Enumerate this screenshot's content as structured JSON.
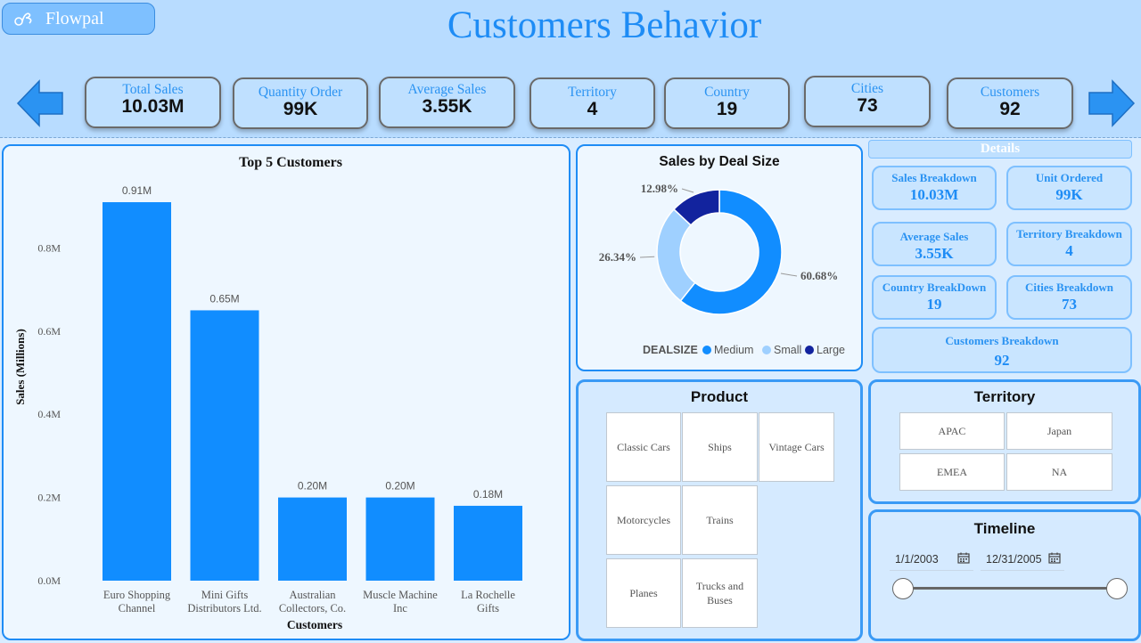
{
  "brand": {
    "name": "Flowpal"
  },
  "header": {
    "title": "Customers Behavior"
  },
  "nav": {
    "prev": "left-arrow-icon",
    "next": "right-arrow-icon"
  },
  "kpis": [
    {
      "label": "Total Sales",
      "value": "10.03M"
    },
    {
      "label": "Quantity Order",
      "value": "99K"
    },
    {
      "label": "Average Sales",
      "value": "3.55K"
    },
    {
      "label": "Territory",
      "value": "4"
    },
    {
      "label": "Country",
      "value": "19"
    },
    {
      "label": "Cities",
      "value": "73"
    },
    {
      "label": "Customers",
      "value": "92"
    }
  ],
  "chart_data": [
    {
      "type": "bar",
      "title": "Top 5 Customers",
      "xlabel": "Customers",
      "ylabel": "Sales (Millions)",
      "categories": [
        "Euro Shopping Channel",
        "Mini Gifts Distributors Ltd.",
        "Australian Collectors, Co.",
        "Muscle Machine Inc",
        "La Rochelle Gifts"
      ],
      "category_lines": [
        [
          "Euro Shopping",
          "Channel"
        ],
        [
          "Mini Gifts",
          "Distributors Ltd."
        ],
        [
          "Australian",
          "Collectors, Co."
        ],
        [
          "Muscle Machine",
          "Inc"
        ],
        [
          "La Rochelle",
          "Gifts"
        ]
      ],
      "values": [
        0.91,
        0.65,
        0.2,
        0.2,
        0.18
      ],
      "data_labels": [
        "0.91M",
        "0.65M",
        "0.20M",
        "0.20M",
        "0.18M"
      ],
      "yticks": [
        0,
        0.2,
        0.4,
        0.6,
        0.8
      ],
      "ytick_labels": [
        "0.0M",
        "0.2M",
        "0.4M",
        "0.6M",
        "0.8M"
      ],
      "ylim": [
        0,
        0.96
      ],
      "color": "#118dff"
    },
    {
      "type": "pie",
      "subtype": "donut",
      "title": "Sales by Deal Size",
      "legend_title": "DEALSIZE",
      "legend_position": "bottom",
      "slices": [
        {
          "name": "Medium",
          "value": 60.68,
          "label": "60.68%",
          "color": "#118dff"
        },
        {
          "name": "Small",
          "value": 26.34,
          "label": "26.34%",
          "color": "#9fd0ff"
        },
        {
          "name": "Large",
          "value": 12.98,
          "label": "12.98%",
          "color": "#12239e"
        }
      ]
    }
  ],
  "details": {
    "title": "Details",
    "cards": [
      {
        "label": "Sales Breakdown",
        "value": "10.03M"
      },
      {
        "label": "Unit Ordered",
        "value": "99K"
      },
      {
        "label": "Average Sales",
        "value": "3.55K"
      },
      {
        "label": "Territory Breakdown",
        "value": "4"
      },
      {
        "label": "Country BreakDown",
        "value": "19"
      },
      {
        "label": "Cities Breakdown",
        "value": "73"
      },
      {
        "label": "Customers Breakdown",
        "value": "92"
      }
    ]
  },
  "product": {
    "title": "Product",
    "items": [
      "Classic Cars",
      "Ships",
      "Vintage Cars",
      "Motorcycles",
      "Trains",
      "Planes",
      "Trucks and Buses"
    ]
  },
  "territory": {
    "title": "Territory",
    "items": [
      "APAC",
      "Japan",
      "EMEA",
      "NA"
    ]
  },
  "timeline": {
    "title": "Timeline",
    "start": "1/1/2003",
    "end": "12/31/2005",
    "range_fraction": [
      0,
      1
    ]
  },
  "colors": {
    "accent": "#1e8cf5",
    "bar": "#118dff",
    "band": "#b8dcff"
  }
}
